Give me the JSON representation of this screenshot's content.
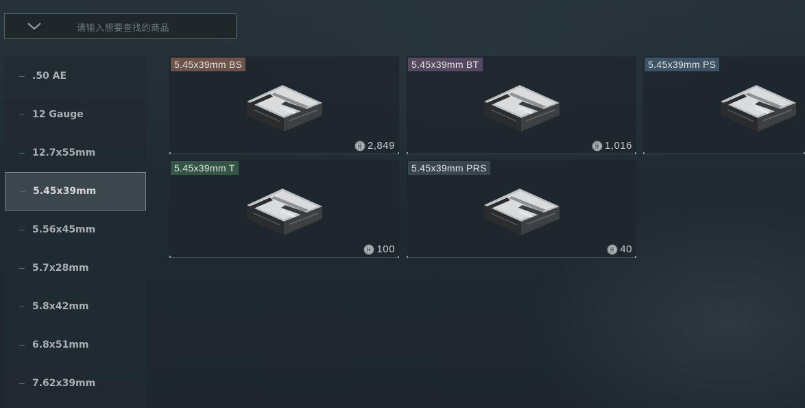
{
  "search": {
    "placeholder": "请输入想要查找的商品",
    "dropdown_icon": "chevron-down-icon"
  },
  "sidebar": {
    "items": [
      {
        "label": ".50 AE",
        "active": false
      },
      {
        "label": "12 Gauge",
        "active": false
      },
      {
        "label": "12.7x55mm",
        "active": false
      },
      {
        "label": "5.45x39mm",
        "active": true
      },
      {
        "label": "5.56x45mm",
        "active": false
      },
      {
        "label": "5.7x28mm",
        "active": false
      },
      {
        "label": "5.8x42mm",
        "active": false
      },
      {
        "label": "6.8x51mm",
        "active": false
      },
      {
        "label": "7.62x39mm",
        "active": false
      }
    ]
  },
  "products": [
    {
      "name": "5.45x39mm BS",
      "price": "2,849",
      "tag_color": "#6e5448",
      "icon": "ammo-box-icon"
    },
    {
      "name": "5.45x39mm BT",
      "price": "1,016",
      "tag_color": "#574862",
      "icon": "ammo-box-icon"
    },
    {
      "name": "5.45x39mm PS",
      "price": "",
      "tag_color": "#3c5466",
      "icon": "ammo-box-icon"
    },
    {
      "name": "5.45x39mm T",
      "price": "100",
      "tag_color": "#355544",
      "icon": "ammo-box-icon"
    },
    {
      "name": "5.45x39mm PRS",
      "price": "40",
      "tag_color": "#3a444c",
      "icon": "ammo-box-icon"
    }
  ],
  "currency_icon": "coin-icon"
}
